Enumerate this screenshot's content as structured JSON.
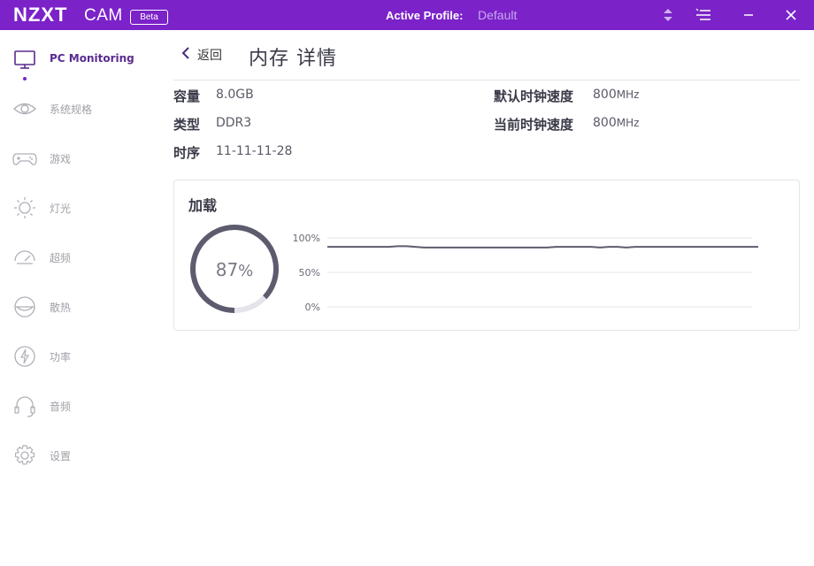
{
  "titlebar": {
    "brand": "NZXT",
    "product": "CAM",
    "badge": "Beta",
    "profile_label": "Active Profile:",
    "profile_value": "Default",
    "controls": [
      "profile-switch-icon",
      "menu-icon",
      "minimize-icon",
      "close-icon"
    ]
  },
  "sidebar": {
    "items": [
      {
        "label": "PC Monitoring",
        "icon": "monitor-icon",
        "active": true
      },
      {
        "label": "系统规格",
        "icon": "eye-icon",
        "active": false
      },
      {
        "label": "游戏",
        "icon": "gamepad-icon",
        "active": false
      },
      {
        "label": "灯光",
        "icon": "sun-icon",
        "active": false
      },
      {
        "label": "超频",
        "icon": "speedometer-icon",
        "active": false
      },
      {
        "label": "散热",
        "icon": "cooling-icon",
        "active": false
      },
      {
        "label": "功率",
        "icon": "power-icon",
        "active": false
      },
      {
        "label": "音频",
        "icon": "headset-icon",
        "active": false
      },
      {
        "label": "设置",
        "icon": "gear-icon",
        "active": false
      }
    ]
  },
  "main": {
    "back_label": "返回",
    "title": "内存 详情",
    "specs": {
      "capacity": {
        "label": "容量",
        "value": "8.0GB"
      },
      "type": {
        "label": "类型",
        "value": "DDR3"
      },
      "timings": {
        "label": "时序",
        "value": "11-11-11-28"
      },
      "default_clock": {
        "label": "默认时钟速度",
        "value": "800",
        "unit": "MHz"
      },
      "current_clock": {
        "label": "当前时钟速度",
        "value": "800",
        "unit": "MHz"
      }
    },
    "load": {
      "title": "加载",
      "percent_value": "87",
      "percent_unit": "%",
      "gauge_fraction": 0.87,
      "colors": {
        "arc": "#5d5c6e",
        "track": "#e4e4ea"
      }
    }
  },
  "chart_data": {
    "type": "line",
    "title": "",
    "xlabel": "",
    "ylabel": "",
    "ylim": [
      0,
      100
    ],
    "y_ticks": [
      "100%",
      "50%",
      "0%"
    ],
    "grid": true,
    "series": [
      {
        "values": [
          87,
          87,
          87,
          87,
          87,
          87,
          87,
          87,
          88,
          88,
          87,
          86,
          86,
          86,
          86,
          86,
          86,
          86,
          86,
          86,
          86,
          86,
          86,
          86,
          86,
          86,
          87,
          87,
          87,
          87,
          87,
          86,
          87,
          87,
          86,
          87,
          87,
          87,
          87,
          87,
          87,
          87,
          87,
          87,
          87,
          87,
          87,
          87,
          87,
          87
        ]
      }
    ]
  }
}
